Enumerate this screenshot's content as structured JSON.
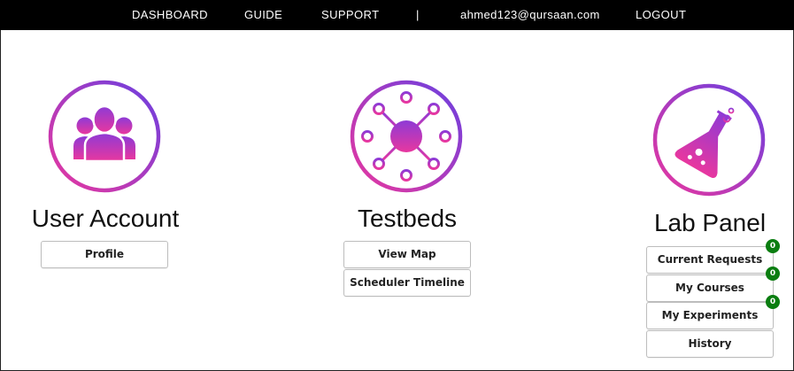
{
  "nav": {
    "dashboard": "DASHBOARD",
    "guide": "GUIDE",
    "support": "SUPPORT",
    "separator": "|",
    "user_email": "ahmed123@qursaan.com",
    "logout": "LOGOUT"
  },
  "colors": {
    "gradient_start": "#e03ba8",
    "gradient_end": "#6a3be0",
    "badge": "#0a7d10",
    "navbar": "#000000"
  },
  "user_account": {
    "icon": "users-group-icon",
    "title": "User Account",
    "buttons": {
      "profile": "Profile"
    }
  },
  "testbeds": {
    "icon": "network-hub-icon",
    "title": "Testbeds",
    "buttons": {
      "view_map": "View Map",
      "scheduler_timeline": "Scheduler Timeline"
    }
  },
  "lab_panel": {
    "icon": "lab-flask-icon",
    "title": "Lab Panel",
    "buttons": {
      "current_requests": "Current Requests",
      "current_requests_count": "0",
      "my_courses": "My Courses",
      "my_courses_count": "0",
      "my_experiments": "My Experiments",
      "my_experiments_count": "0",
      "history": "History"
    }
  }
}
